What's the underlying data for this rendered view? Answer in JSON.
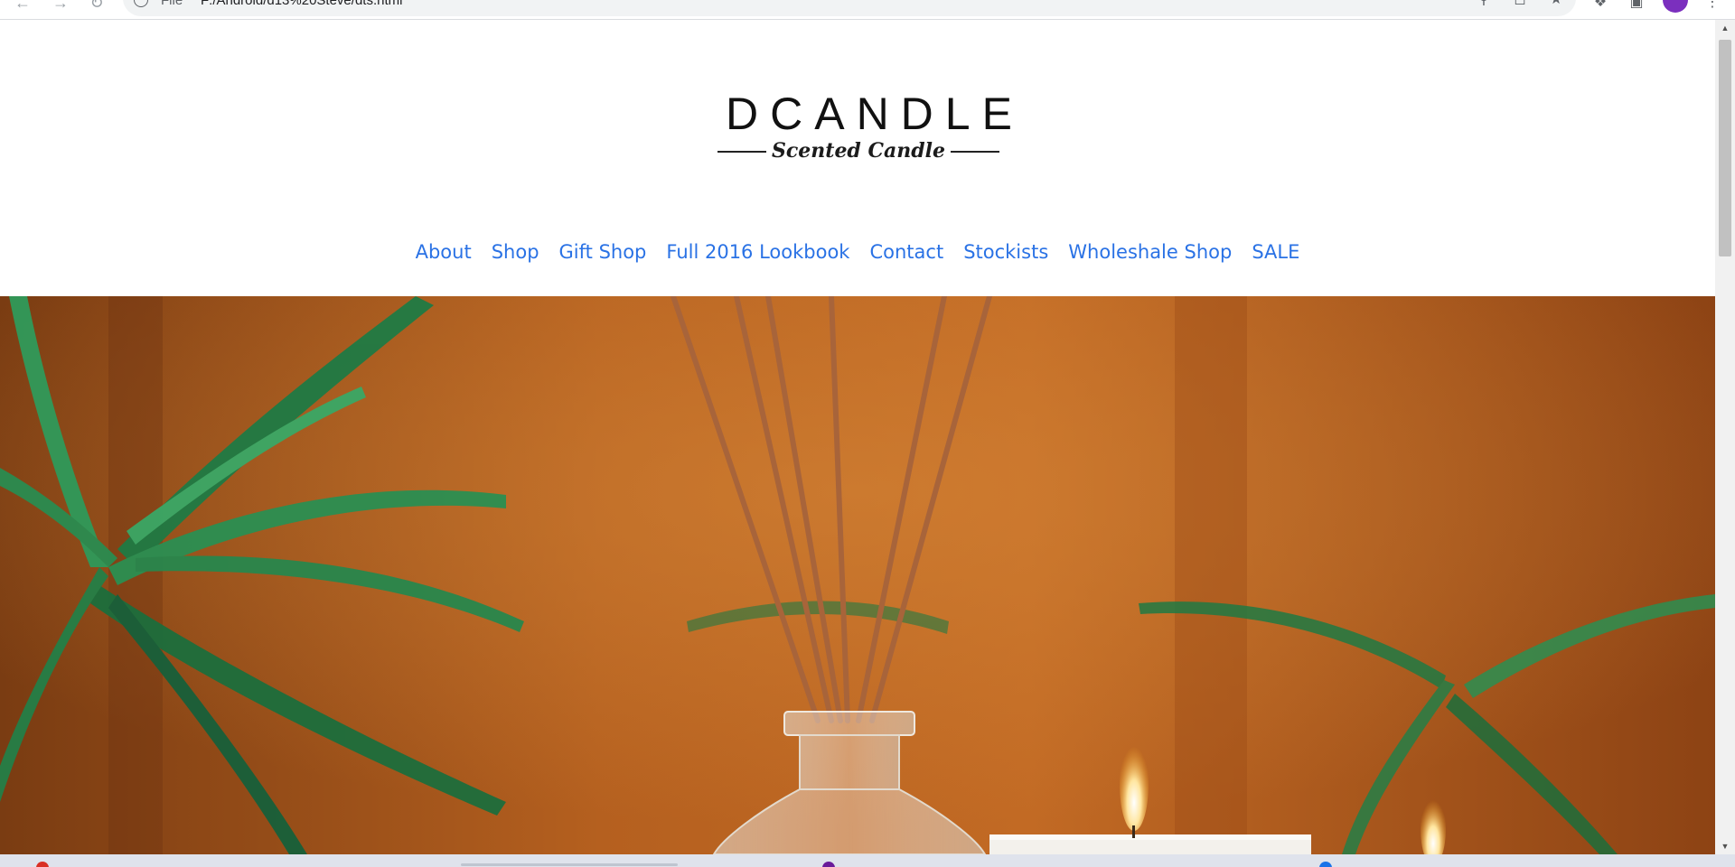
{
  "browser": {
    "scheme_label": "File",
    "url": "F:/Android/d13%20Steve/dts.html",
    "icons": {
      "back": "arrow-left-icon",
      "forward": "arrow-right-icon",
      "reload": "reload-icon",
      "info": "info-icon",
      "zoom": "zoom-icon",
      "share": "share-icon",
      "bookmark": "star-icon",
      "extensions": "puzzle-icon",
      "window": "window-icon",
      "menu": "menu-dots-icon"
    }
  },
  "site": {
    "logo": {
      "main": "DCANDLE",
      "sub": "Scented Candle"
    },
    "nav": [
      "About",
      "Shop",
      "Gift Shop",
      "Full 2016 Lookbook",
      "Contact",
      "Stockists",
      "Wholeshale Shop",
      "SALE"
    ],
    "link_color": "#2a72e5"
  },
  "hero": {
    "subject": "reed diffuser and lit candles with palm leaves"
  }
}
